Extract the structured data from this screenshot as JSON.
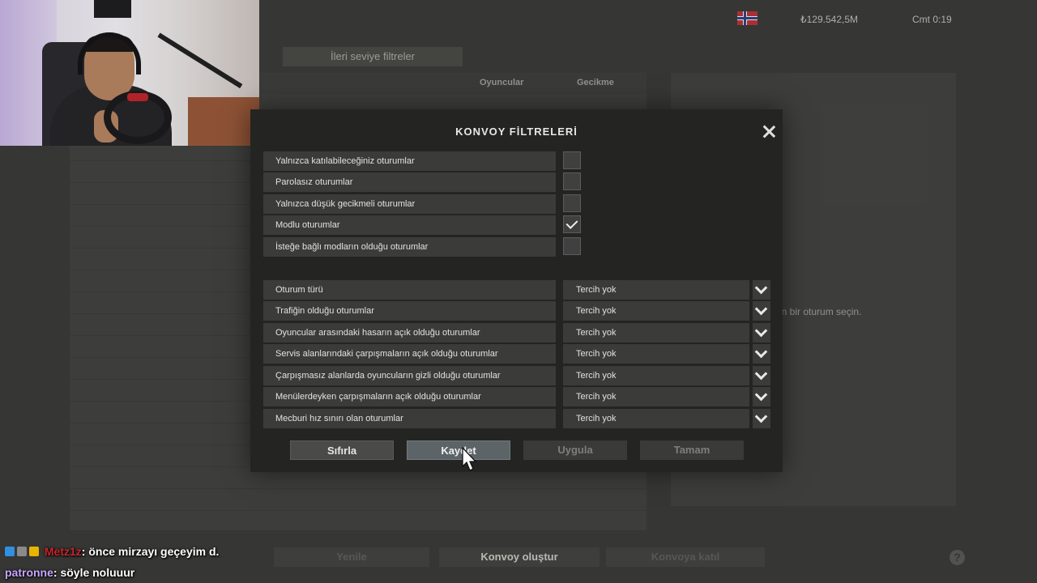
{
  "topbar": {
    "money": "₺129.542,5M",
    "clock": "Cmt 0:19",
    "flag": "norway-flag"
  },
  "background": {
    "advanced_filters_button": "İleri seviye filtreler",
    "columns": {
      "players": "Oyuncular",
      "latency": "Gecikme"
    },
    "info_hint": "en bir oturum seçin.",
    "buttons": {
      "refresh": "Yenile",
      "create_convoy": "Konvoy oluştur",
      "join_convoy": "Konvoya katıl"
    },
    "help_icon": "?"
  },
  "dialog": {
    "title": "KONVOY FİLTRELERİ",
    "close_icon": "close-icon",
    "checkboxes": [
      {
        "label": "Yalnızca katılabileceğiniz oturumlar",
        "checked": false
      },
      {
        "label": "Parolasız oturumlar",
        "checked": false
      },
      {
        "label": "Yalnızca düşük gecikmeli oturumlar",
        "checked": false
      },
      {
        "label": "Modlu oturumlar",
        "checked": true
      },
      {
        "label": "İsteğe bağlı modların olduğu oturumlar",
        "checked": false
      }
    ],
    "selects": [
      {
        "label": "Oturum türü",
        "value": "Tercih yok"
      },
      {
        "label": "Trafiğin olduğu oturumlar",
        "value": "Tercih yok"
      },
      {
        "label": "Oyuncular arasındaki hasarın açık olduğu oturumlar",
        "value": "Tercih yok"
      },
      {
        "label": "Servis alanlarındaki çarpışmaların açık olduğu oturumlar",
        "value": "Tercih yok"
      },
      {
        "label": "Çarpışmasız alanlarda oyuncuların gizli olduğu oturumlar",
        "value": "Tercih yok"
      },
      {
        "label": "Menülerdeyken çarpışmaların açık olduğu oturumlar",
        "value": "Tercih yok"
      },
      {
        "label": "Mecburi hız sınırı olan oturumlar",
        "value": "Tercih yok"
      }
    ],
    "buttons": {
      "reset": "Sıfırla",
      "save": "Kaydet",
      "apply": "Uygula",
      "ok": "Tamam"
    }
  },
  "chat": [
    {
      "user": "Metz1z",
      "message": ": önce mirzayı geçeyim d."
    },
    {
      "user": "patronne",
      "message": ": söyle noluuur"
    }
  ]
}
